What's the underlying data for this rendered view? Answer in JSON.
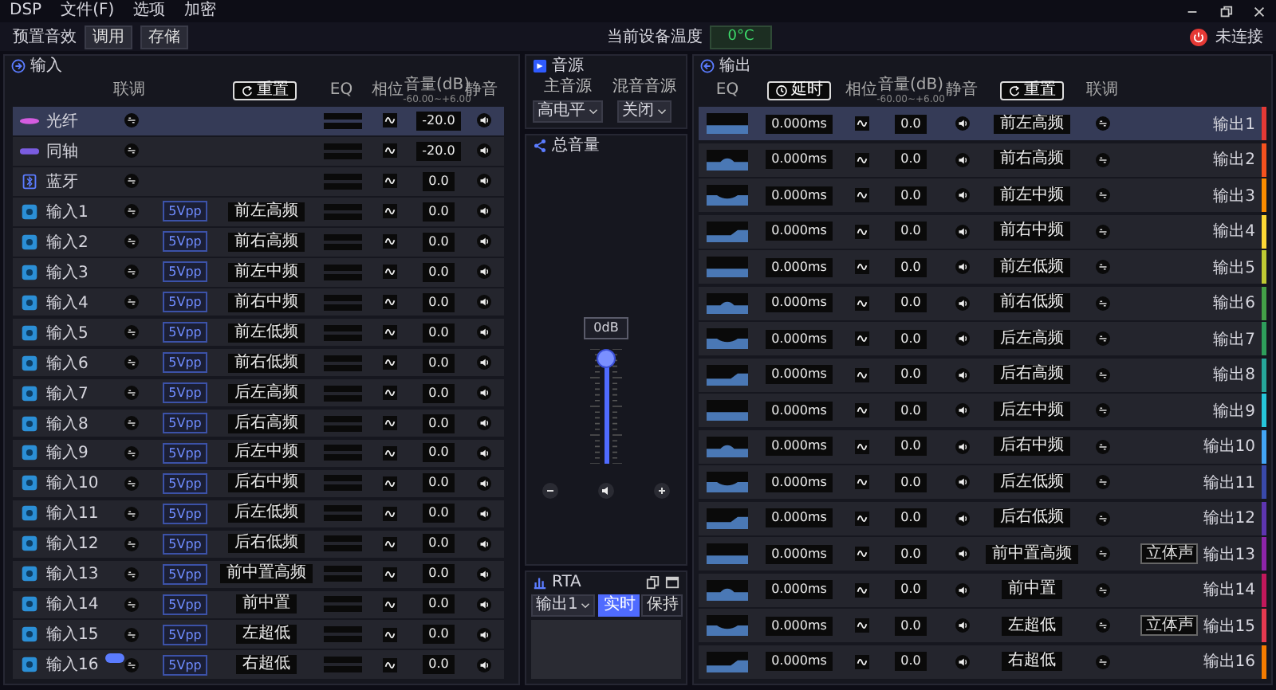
{
  "menu": [
    "DSP",
    "文件(F)",
    "选项",
    "加密"
  ],
  "toolbar": {
    "preset_label": "预置音效",
    "buttons": [
      "调用",
      "存储"
    ],
    "temperature_label": "当前设备温度",
    "temperature": "0°C",
    "connection": "未连接"
  },
  "input_panel": {
    "title": "输入",
    "columns": {
      "link": "联调",
      "reset": "重置",
      "eq": "EQ",
      "phase": "相位",
      "volume": "音量(dB)",
      "volume_range": "-60.00~+6.00",
      "mute": "静音"
    },
    "rows": [
      {
        "kind": "optical",
        "name": "光纤",
        "volume": "-20.0",
        "selected": true,
        "tagged": false
      },
      {
        "kind": "coaxial",
        "name": "同轴",
        "volume": "-20.0",
        "selected": false,
        "tagged": false
      },
      {
        "kind": "bluetooth",
        "name": "蓝牙",
        "volume": "0.0",
        "selected": false,
        "tagged": false
      },
      {
        "kind": "analog",
        "name": "输入1",
        "sensitivity": "5Vpp",
        "channel": "前左高频",
        "volume": "0.0",
        "selected": false,
        "tagged": false
      },
      {
        "kind": "analog",
        "name": "输入2",
        "sensitivity": "5Vpp",
        "channel": "前右高频",
        "volume": "0.0",
        "selected": false,
        "tagged": false
      },
      {
        "kind": "analog",
        "name": "输入3",
        "sensitivity": "5Vpp",
        "channel": "前左中频",
        "volume": "0.0",
        "selected": false,
        "tagged": false
      },
      {
        "kind": "analog",
        "name": "输入4",
        "sensitivity": "5Vpp",
        "channel": "前右中频",
        "volume": "0.0",
        "selected": false,
        "tagged": false
      },
      {
        "kind": "analog",
        "name": "输入5",
        "sensitivity": "5Vpp",
        "channel": "前左低频",
        "volume": "0.0",
        "selected": false,
        "tagged": false
      },
      {
        "kind": "analog",
        "name": "输入6",
        "sensitivity": "5Vpp",
        "channel": "前右低频",
        "volume": "0.0",
        "selected": false,
        "tagged": false
      },
      {
        "kind": "analog",
        "name": "输入7",
        "sensitivity": "5Vpp",
        "channel": "后左高频",
        "volume": "0.0",
        "selected": false,
        "tagged": false
      },
      {
        "kind": "analog",
        "name": "输入8",
        "sensitivity": "5Vpp",
        "channel": "后右高频",
        "volume": "0.0",
        "selected": false,
        "tagged": false
      },
      {
        "kind": "analog",
        "name": "输入9",
        "sensitivity": "5Vpp",
        "channel": "后左中频",
        "volume": "0.0",
        "selected": false,
        "tagged": false
      },
      {
        "kind": "analog",
        "name": "输入10",
        "sensitivity": "5Vpp",
        "channel": "后右中频",
        "volume": "0.0",
        "selected": false,
        "tagged": false
      },
      {
        "kind": "analog",
        "name": "输入11",
        "sensitivity": "5Vpp",
        "channel": "后左低频",
        "volume": "0.0",
        "selected": false,
        "tagged": false
      },
      {
        "kind": "analog",
        "name": "输入12",
        "sensitivity": "5Vpp",
        "channel": "后右低频",
        "volume": "0.0",
        "selected": false,
        "tagged": false
      },
      {
        "kind": "analog",
        "name": "输入13",
        "sensitivity": "5Vpp",
        "channel": "前中置高频",
        "volume": "0.0",
        "selected": false,
        "tagged": false
      },
      {
        "kind": "analog",
        "name": "输入14",
        "sensitivity": "5Vpp",
        "channel": "前中置",
        "volume": "0.0",
        "selected": false,
        "tagged": false
      },
      {
        "kind": "analog",
        "name": "输入15",
        "sensitivity": "5Vpp",
        "channel": "左超低",
        "volume": "0.0",
        "selected": false,
        "tagged": false
      },
      {
        "kind": "analog",
        "name": "输入16",
        "sensitivity": "5Vpp",
        "channel": "右超低",
        "volume": "0.0",
        "selected": false,
        "tagged": true
      }
    ]
  },
  "source_panel": {
    "title": "音源",
    "main_label": "主音源",
    "main_value": "高电平",
    "mix_label": "混音音源",
    "mix_value": "关闭"
  },
  "master": {
    "title": "总音量",
    "reading": "0dB",
    "level": 0.91
  },
  "rta": {
    "title": "RTA",
    "channel": "输出1",
    "modes": [
      {
        "label": "实时",
        "selected": true
      },
      {
        "label": "保持",
        "selected": false
      }
    ]
  },
  "output_panel": {
    "title": "输出",
    "columns": {
      "eq": "EQ",
      "delay": "延时",
      "phase": "相位",
      "volume": "音量(dB)",
      "volume_range": "-60.00~+6.00",
      "mute": "静音",
      "reset": "重置",
      "link": "联调"
    },
    "rows": [
      {
        "label": "输出1",
        "delay": "0.000ms",
        "volume": "0.0",
        "channel": "前左高频",
        "color": "#e53935",
        "selected": true
      },
      {
        "label": "输出2",
        "delay": "0.000ms",
        "volume": "0.0",
        "channel": "前右高频",
        "color": "#f4511e",
        "selected": false
      },
      {
        "label": "输出3",
        "delay": "0.000ms",
        "volume": "0.0",
        "channel": "前左中频",
        "color": "#fb8c00",
        "selected": false
      },
      {
        "label": "输出4",
        "delay": "0.000ms",
        "volume": "0.0",
        "channel": "前右中频",
        "color": "#fdd835",
        "selected": false
      },
      {
        "label": "输出5",
        "delay": "0.000ms",
        "volume": "0.0",
        "channel": "前左低频",
        "color": "#c0ca33",
        "selected": false
      },
      {
        "label": "输出6",
        "delay": "0.000ms",
        "volume": "0.0",
        "channel": "前右低频",
        "color": "#43a047",
        "selected": false
      },
      {
        "label": "输出7",
        "delay": "0.000ms",
        "volume": "0.0",
        "channel": "后左高频",
        "color": "#2e9e5b",
        "selected": false
      },
      {
        "label": "输出8",
        "delay": "0.000ms",
        "volume": "0.0",
        "channel": "后右高频",
        "color": "#26a69a",
        "selected": false
      },
      {
        "label": "输出9",
        "delay": "0.000ms",
        "volume": "0.0",
        "channel": "后左中频",
        "color": "#26c6da",
        "selected": false
      },
      {
        "label": "输出10",
        "delay": "0.000ms",
        "volume": "0.0",
        "channel": "后右中频",
        "color": "#42a5f5",
        "selected": false
      },
      {
        "label": "输出11",
        "delay": "0.000ms",
        "volume": "0.0",
        "channel": "后左低频",
        "color": "#3949ab",
        "selected": false
      },
      {
        "label": "输出12",
        "delay": "0.000ms",
        "volume": "0.0",
        "channel": "后右低频",
        "color": "#5e35b1",
        "selected": false
      },
      {
        "label": "输出13",
        "delay": "0.000ms",
        "volume": "0.0",
        "channel": "前中置高频",
        "color": "#8e24aa",
        "selected": false,
        "pair_button": "立体声"
      },
      {
        "label": "输出14",
        "delay": "0.000ms",
        "volume": "0.0",
        "channel": "前中置",
        "color": "#c2185b",
        "selected": false
      },
      {
        "label": "输出15",
        "delay": "0.000ms",
        "volume": "0.0",
        "channel": "左超低",
        "color": "#e53950",
        "selected": false,
        "pair_button": "立体声"
      },
      {
        "label": "输出16",
        "delay": "0.000ms",
        "volume": "0.0",
        "channel": "右超低",
        "color": "#f57c00",
        "selected": false
      }
    ]
  }
}
